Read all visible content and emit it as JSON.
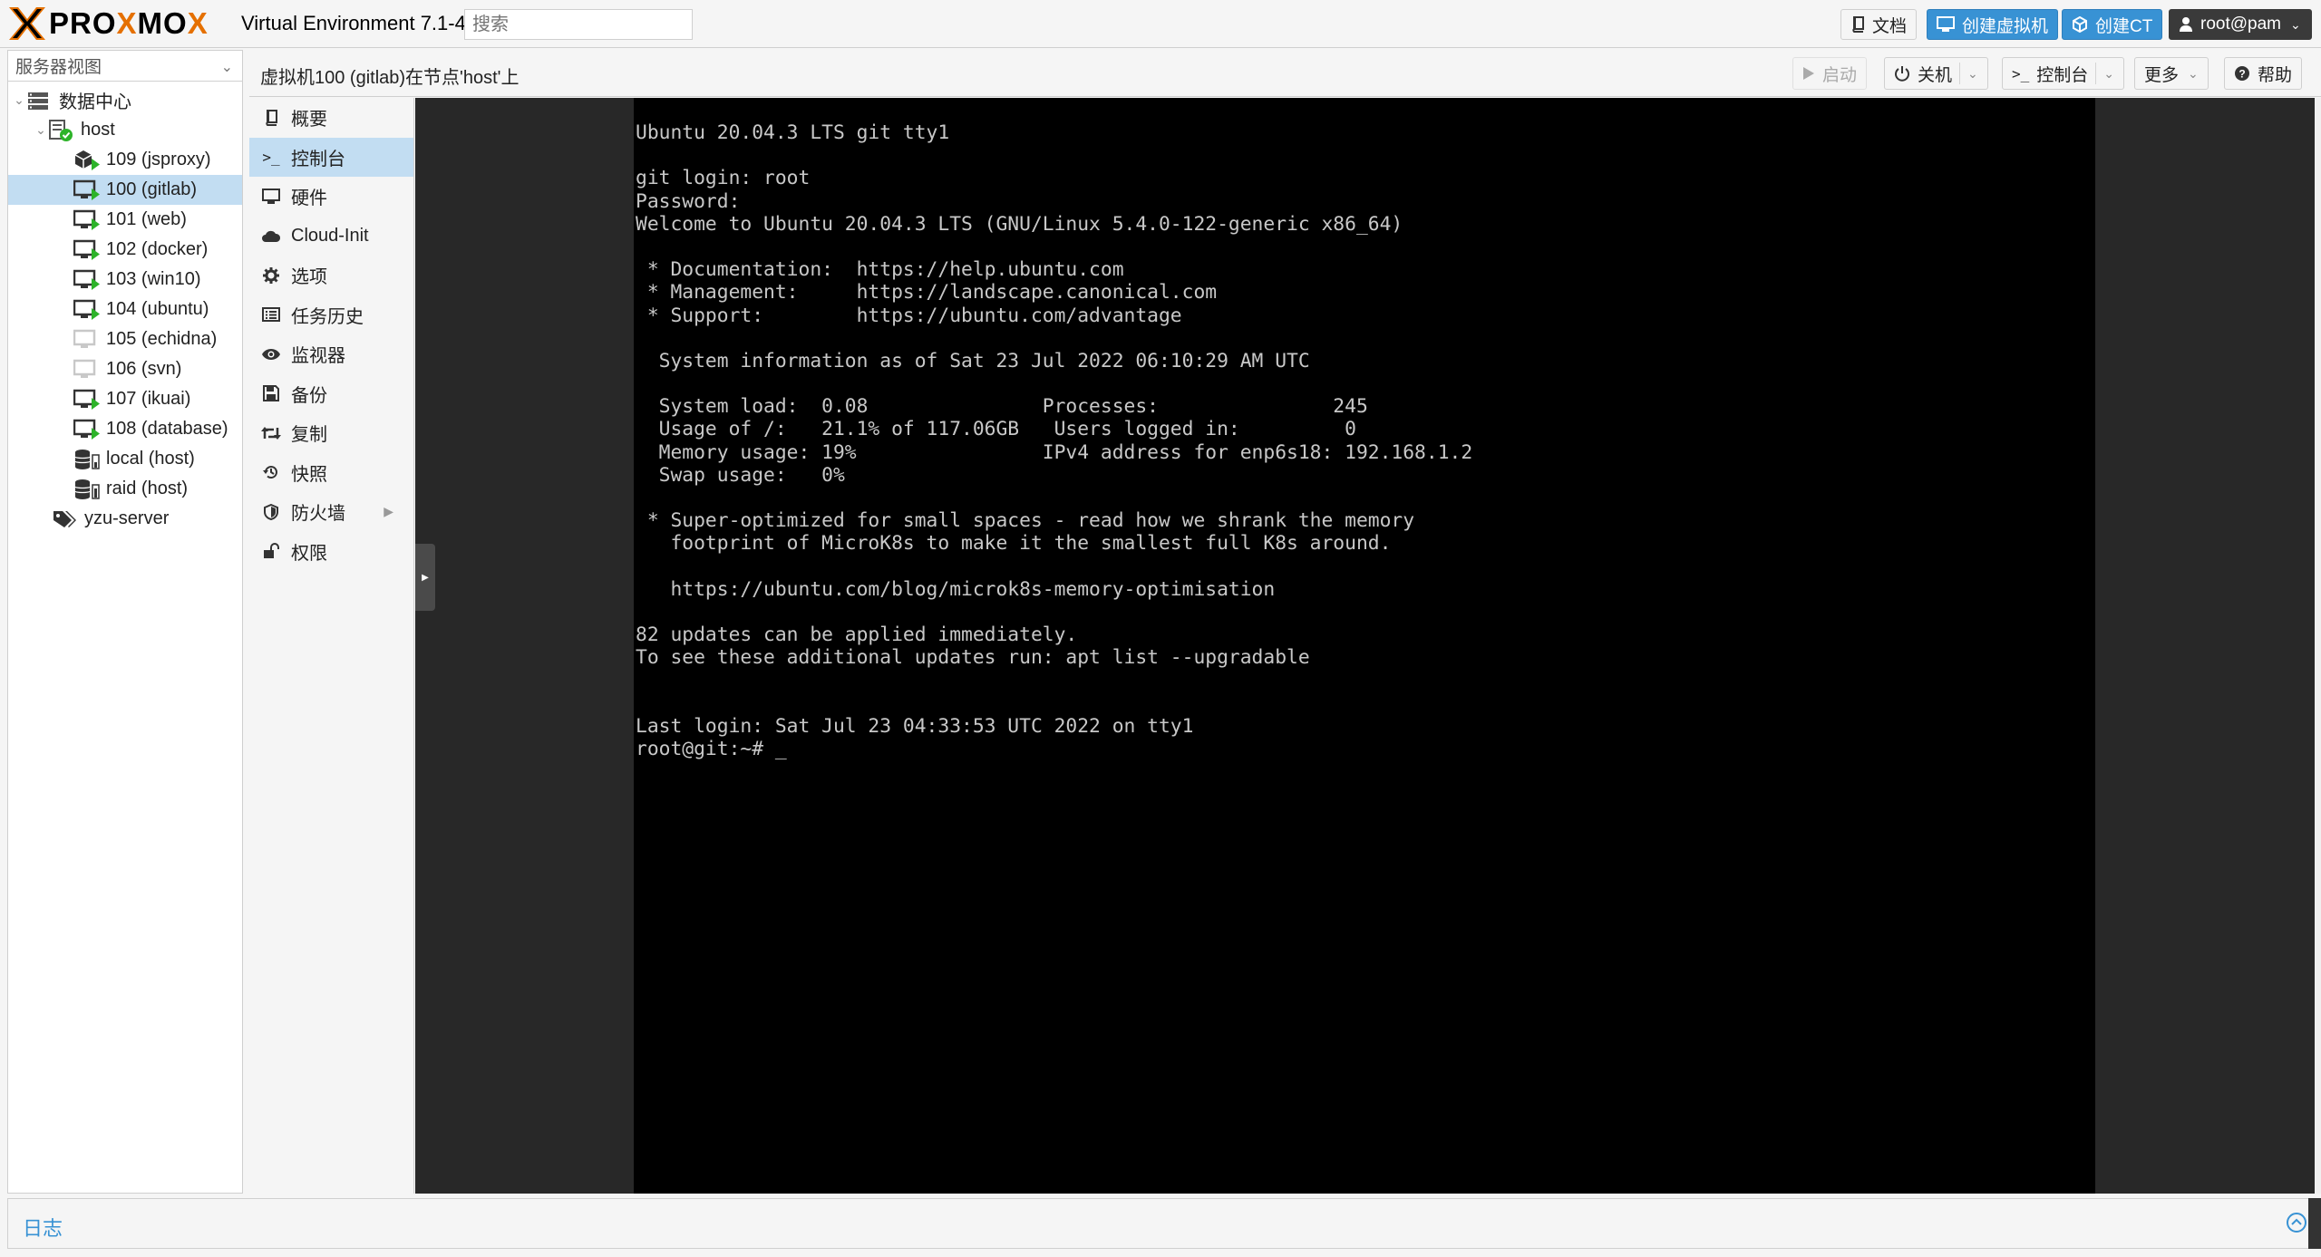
{
  "app": {
    "logo_text_1": "PRO",
    "logo_text_x": "X",
    "logo_text_2": "MO",
    "logo_text_3": "X",
    "version": "Virtual Environment 7.1-4",
    "search_placeholder": "搜索"
  },
  "header_buttons": {
    "docs": "文档",
    "create_vm": "创建虚拟机",
    "create_ct": "创建CT",
    "user": "root@pam"
  },
  "colors": {
    "accent": "#3892d4",
    "brand_orange": "#e57000",
    "selection": "#c2ddf2",
    "running_green": "#2db329"
  },
  "tree": {
    "view_label": "服务器视图",
    "datacenter": "数据中心",
    "node": "host",
    "items": [
      {
        "label": "109 (jsproxy)",
        "icon": "container-icon",
        "running": true
      },
      {
        "label": "100 (gitlab)",
        "icon": "vm-monitor-icon",
        "running": true,
        "selected": true
      },
      {
        "label": "101 (web)",
        "icon": "vm-monitor-icon",
        "running": true
      },
      {
        "label": "102 (docker)",
        "icon": "vm-monitor-icon",
        "running": true
      },
      {
        "label": "103 (win10)",
        "icon": "vm-monitor-icon",
        "running": true
      },
      {
        "label": "104 (ubuntu)",
        "icon": "vm-monitor-icon",
        "running": true
      },
      {
        "label": "105 (echidna)",
        "icon": "vm-monitor-icon",
        "running": false
      },
      {
        "label": "106 (svn)",
        "icon": "vm-monitor-icon",
        "running": false
      },
      {
        "label": "107 (ikuai)",
        "icon": "vm-monitor-icon",
        "running": true
      },
      {
        "label": "108 (database)",
        "icon": "vm-monitor-icon",
        "running": true
      },
      {
        "label": "local (host)",
        "icon": "storage-icon",
        "running": false
      },
      {
        "label": "raid (host)",
        "icon": "storage-icon",
        "running": false
      }
    ],
    "pool": "yzu-server"
  },
  "nav": {
    "items": [
      {
        "label": "概要",
        "icon": "book-icon"
      },
      {
        "label": "控制台",
        "icon": "terminal-icon",
        "selected": true
      },
      {
        "label": "硬件",
        "icon": "monitor-icon"
      },
      {
        "label": "Cloud-Init",
        "icon": "cloud-icon"
      },
      {
        "label": "选项",
        "icon": "gear-icon"
      },
      {
        "label": "任务历史",
        "icon": "list-icon"
      },
      {
        "label": "监视器",
        "icon": "eye-icon"
      },
      {
        "label": "备份",
        "icon": "floppy-icon"
      },
      {
        "label": "复制",
        "icon": "retweet-icon"
      },
      {
        "label": "快照",
        "icon": "history-icon"
      },
      {
        "label": "防火墙",
        "icon": "shield-icon",
        "has_submenu": true
      },
      {
        "label": "权限",
        "icon": "unlock-icon"
      }
    ]
  },
  "content": {
    "title": "虚拟机100 (gitlab)在节点'host'上",
    "start": "启动",
    "shutdown": "关机",
    "console": "控制台",
    "more": "更多",
    "help": "帮助"
  },
  "terminal": {
    "lines": [
      "Ubuntu 20.04.3 LTS git tty1",
      "",
      "git login: root",
      "Password:",
      "Welcome to Ubuntu 20.04.3 LTS (GNU/Linux 5.4.0-122-generic x86_64)",
      "",
      " * Documentation:  https://help.ubuntu.com",
      " * Management:     https://landscape.canonical.com",
      " * Support:        https://ubuntu.com/advantage",
      "",
      "  System information as of Sat 23 Jul 2022 06:10:29 AM UTC",
      "",
      "  System load:  0.08               Processes:               245",
      "  Usage of /:   21.1% of 117.06GB   Users logged in:         0",
      "  Memory usage: 19%                IPv4 address for enp6s18: 192.168.1.2",
      "  Swap usage:   0%",
      "",
      " * Super-optimized for small spaces - read how we shrank the memory",
      "   footprint of MicroK8s to make it the smallest full K8s around.",
      "",
      "   https://ubuntu.com/blog/microk8s-memory-optimisation",
      "",
      "82 updates can be applied immediately.",
      "To see these additional updates run: apt list --upgradable",
      "",
      "",
      "Last login: Sat Jul 23 04:33:53 UTC 2022 on tty1",
      "root@git:~# _"
    ]
  },
  "log": {
    "title": "日志"
  }
}
